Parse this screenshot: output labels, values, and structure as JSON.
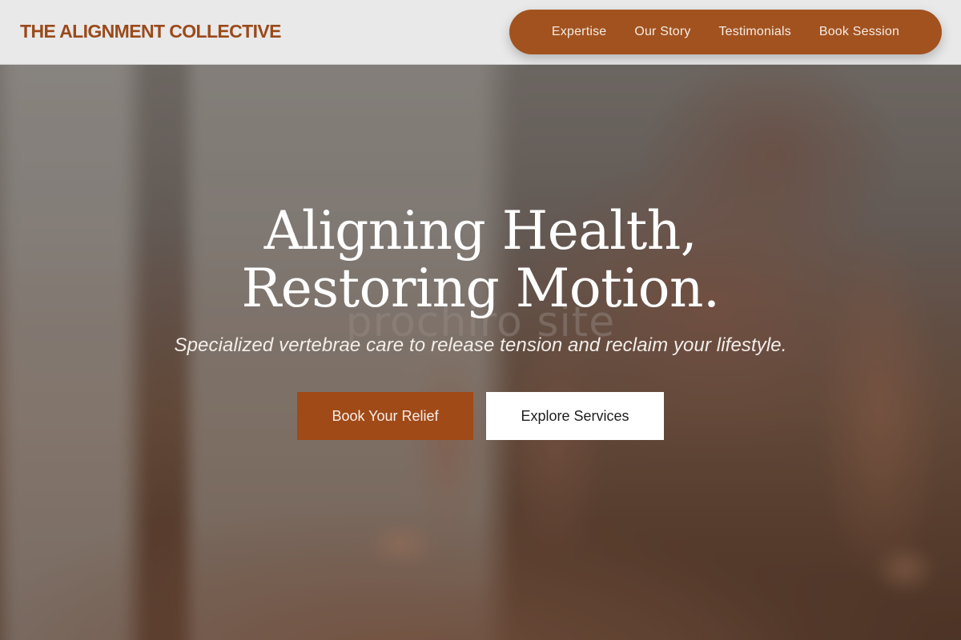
{
  "header": {
    "brand": "THE ALIGNMENT COLLECTIVE",
    "nav": [
      {
        "label": "Expertise"
      },
      {
        "label": "Our Story"
      },
      {
        "label": "Testimonials"
      },
      {
        "label": "Book Session"
      }
    ]
  },
  "hero": {
    "headline_line1": "Aligning Health,",
    "headline_line2": "Restoring Motion.",
    "watermark": "prochiro site",
    "subtitle": "Specialized vertebrae care to release tension and reclaim your lifestyle.",
    "primary_cta": "Book Your Relief",
    "secondary_cta": "Explore Services"
  },
  "colors": {
    "accent": "#a2521f",
    "brand_text": "#9a4a1b",
    "header_bg": "#e9e9e9",
    "primary_button": "#a04a18",
    "secondary_button": "#ffffff"
  }
}
